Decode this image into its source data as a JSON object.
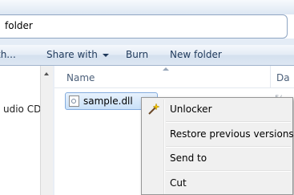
{
  "address": {
    "path_fragment": "folder"
  },
  "toolbar": {
    "items": [
      {
        "label": "th..."
      },
      {
        "label": "Share with"
      },
      {
        "label": "Burn"
      },
      {
        "label": "New folder"
      }
    ]
  },
  "nav": {
    "item_label": "udio CD"
  },
  "file_list": {
    "columns": {
      "name": "Name",
      "date": "Da"
    },
    "files": [
      {
        "name": "sample.dll",
        "date_fragment": "5/"
      }
    ]
  },
  "context_menu": {
    "items": [
      {
        "label": "Unlocker",
        "icon": "magic-wand-icon"
      },
      {
        "label": "Restore previous versions"
      },
      {
        "label": "Send to"
      },
      {
        "label": "Cut"
      }
    ]
  },
  "colors": {
    "selection": "#cce4fa",
    "menu_bg": "#f0f0f0",
    "accent": "#1e395b"
  }
}
